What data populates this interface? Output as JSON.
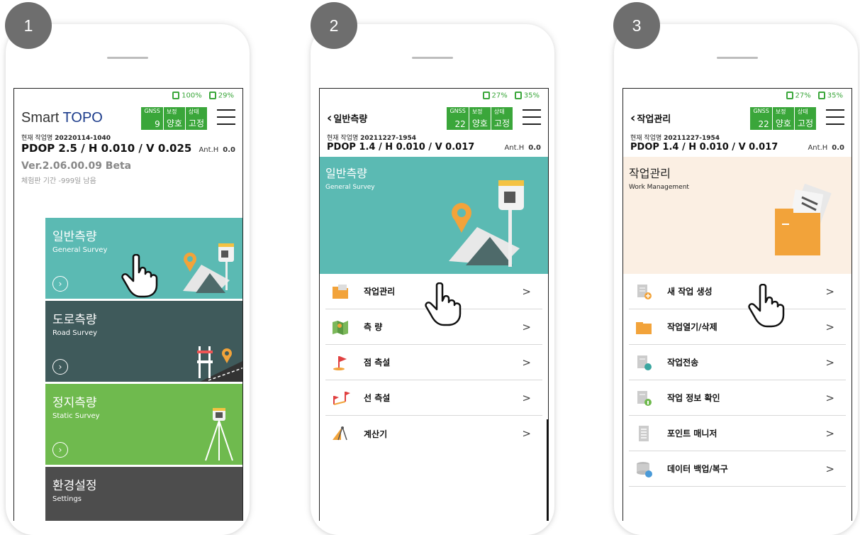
{
  "steps": [
    "1",
    "2",
    "3"
  ],
  "status": {
    "p1_signal": "100%",
    "p1_battery": "29%",
    "p2_signal": "27%",
    "p2_battery": "35%",
    "p3_signal": "27%",
    "p3_battery": "35%"
  },
  "app": {
    "name_prefix": "Smart ",
    "name_brand": "TOPO"
  },
  "gnss_labels": {
    "gnss": "GNSS",
    "correction": "보정",
    "state": "상태"
  },
  "screen1": {
    "gnss_value": "9",
    "correction_value": "양호",
    "state_value": "고정",
    "job_label": "현재 작업명",
    "job_name": "20220114-1040",
    "pdop": "PDOP 2.5 / H 0.010 / V 0.025",
    "ant_label": "Ant.H",
    "ant_value": "0.0",
    "version": "Ver.2.06.00.09  Beta",
    "trial": "체험판 기간 -999일 남음",
    "tiles": [
      {
        "kt": "일반측량",
        "et": "General Survey"
      },
      {
        "kt": "도로측량",
        "et": "Road Survey"
      },
      {
        "kt": "정지측량",
        "et": "Static Survey"
      },
      {
        "kt": "환경설정",
        "et": "Settings"
      }
    ]
  },
  "screen2": {
    "back_title": "일반측량",
    "gnss_value": "22",
    "correction_value": "양호",
    "state_value": "고정",
    "job_label": "현재 작업명",
    "job_name": "20211227-1954",
    "pdop": "PDOP 1.4 / H 0.010 / V 0.017",
    "ant_label": "Ant.H",
    "ant_value": "0.0",
    "hero_kt": "일반측량",
    "hero_et": "General Survey",
    "items": [
      "작업관리",
      "측 량",
      "점 측설",
      "선 측설",
      "계산기"
    ]
  },
  "screen3": {
    "back_title": "작업관리",
    "gnss_value": "22",
    "correction_value": "양호",
    "state_value": "고정",
    "job_label": "현재 작업명",
    "job_name": "20211227-1954",
    "pdop": "PDOP 1.4 / H 0.010 / V 0.017",
    "ant_label": "Ant.H",
    "ant_value": "0.0",
    "hero_kt": "작업관리",
    "hero_et": "Work Management",
    "items": [
      "새 작업 생성",
      "작업열기/삭제",
      "작업전송",
      "작업 정보 확인",
      "포인트 매니저",
      "데이터 백업/복구"
    ]
  },
  "colors": {
    "teal": "#5bbab3",
    "dark_teal": "#3f5a5b",
    "green": "#6fba4e",
    "dark": "#4d4d4d",
    "gnss_green": "#3aa63a",
    "peach": "#fbefe3",
    "orange": "#f2a33a"
  }
}
